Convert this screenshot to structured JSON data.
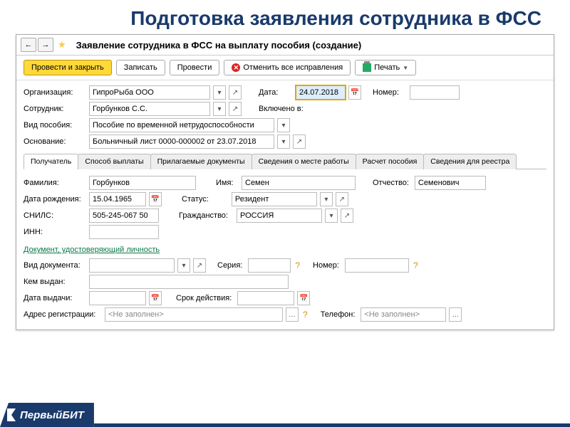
{
  "pageTitle": "Подготовка заявления сотрудника в ФСС",
  "window": {
    "title": "Заявление сотрудника в ФСС на выплату пособия (создание)"
  },
  "toolbar": {
    "submit": "Провести и закрыть",
    "save": "Записать",
    "post": "Провести",
    "cancelAll": "Отменить все исправления",
    "print": "Печать"
  },
  "header": {
    "orgLabel": "Организация:",
    "orgValue": "ГипроРыба ООО",
    "dateLabel": "Дата:",
    "dateValue": "24.07.2018",
    "numberLabel": "Номер:",
    "numberValue": "",
    "employeeLabel": "Сотрудник:",
    "employeeValue": "Горбунков С.С.",
    "includedLabel": "Включено в:",
    "benefitTypeLabel": "Вид пособия:",
    "benefitTypeValue": "Пособие по временной нетрудоспособности",
    "basisLabel": "Основание:",
    "basisValue": "Больничный лист 0000-000002 от 23.07.2018"
  },
  "tabs": {
    "t1": "Получатель",
    "t2": "Способ выплаты",
    "t3": "Прилагаемые документы",
    "t4": "Сведения о месте работы",
    "t5": "Расчет пособия",
    "t6": "Сведения для реестра"
  },
  "recipient": {
    "lastnameLabel": "Фамилия:",
    "lastnameValue": "Горбунков",
    "firstnameLabel": "Имя:",
    "firstnameValue": "Семен",
    "patronymicLabel": "Отчество:",
    "patronymicValue": "Семенович",
    "dobLabel": "Дата рождения:",
    "dobValue": "15.04.1965",
    "statusLabel": "Статус:",
    "statusValue": "Резидент",
    "snilsLabel": "СНИЛС:",
    "snilsValue": "505-245-067 50",
    "citizenshipLabel": "Гражданство:",
    "citizenshipValue": "РОССИЯ",
    "innLabel": "ИНН:",
    "innValue": "",
    "idDocSection": "Документ, удостоверяющий личность",
    "docTypeLabel": "Вид документа:",
    "docTypeValue": "",
    "seriesLabel": "Серия:",
    "seriesValue": "",
    "docNumberLabel": "Номер:",
    "docNumberValue": "",
    "issuedByLabel": "Кем выдан:",
    "issuedByValue": "",
    "issueDateLabel": "Дата выдачи:",
    "issueDateValue": "",
    "validityLabel": "Срок действия:",
    "validityValue": "",
    "addressLabel": "Адрес регистрации:",
    "addressValue": "<Не заполнен>",
    "phoneLabel": "Телефон:",
    "phoneValue": "<Не заполнен>"
  },
  "footer": {
    "brand": "ПервыйБИТ"
  }
}
